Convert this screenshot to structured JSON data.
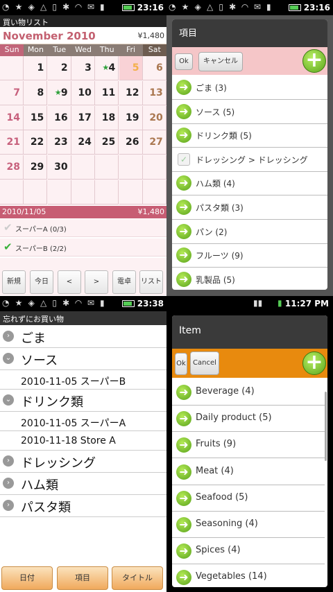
{
  "q1": {
    "status": {
      "time": "23:16"
    },
    "title": "買い物リスト",
    "month": "November 2010",
    "total": "¥1,480",
    "weekdays": [
      "Sun",
      "Mon",
      "Tue",
      "Wed",
      "Thu",
      "Fri",
      "Sat"
    ],
    "weeks": [
      [
        "",
        "1",
        "2",
        "3",
        "4",
        "5",
        "6"
      ],
      [
        "7",
        "8",
        "9",
        "10",
        "11",
        "12",
        "13"
      ],
      [
        "14",
        "15",
        "16",
        "17",
        "18",
        "19",
        "20"
      ],
      [
        "21",
        "22",
        "23",
        "24",
        "25",
        "26",
        "27"
      ],
      [
        "28",
        "29",
        "30",
        "",
        "",
        "",
        ""
      ],
      [
        "",
        "",
        "",
        "",
        "",
        "",
        ""
      ]
    ],
    "star_days": [
      "4",
      "9"
    ],
    "today": "5",
    "selected_date": "2010/11/05",
    "selected_amount": "¥1,480",
    "items": [
      {
        "label": "スーパーA (0/3)",
        "checked": false
      },
      {
        "label": "スーパーB (2/2)",
        "checked": true
      }
    ],
    "buttons": [
      "新規",
      "今日",
      "<",
      ">",
      "電卓",
      "リスト"
    ]
  },
  "q2": {
    "status": {
      "time": "23:16"
    },
    "dialog_title": "項目",
    "ok": "Ok",
    "cancel": "キャンセル",
    "rows": [
      {
        "label": "ごま (3)",
        "icon": "arrow-right-icon"
      },
      {
        "label": "ソース (5)",
        "icon": "arrow-right-icon"
      },
      {
        "label": "ドリンク類 (5)",
        "icon": "arrow-right-icon"
      },
      {
        "label": "ドレッシング > ドレッシング",
        "icon": "checkbox-icon"
      },
      {
        "label": "ハム類 (4)",
        "icon": "arrow-right-icon"
      },
      {
        "label": "パスタ類 (3)",
        "icon": "arrow-right-icon"
      },
      {
        "label": "パン (2)",
        "icon": "arrow-right-icon"
      },
      {
        "label": "フルーツ (9)",
        "icon": "arrow-right-icon"
      },
      {
        "label": "乳製品 (5)",
        "icon": "arrow-right-icon"
      }
    ]
  },
  "q3": {
    "status": {
      "time": "23:38"
    },
    "title": "忘れずにお買い物",
    "tree": [
      {
        "label": "ごま",
        "level": 0,
        "expanded": false
      },
      {
        "label": "ソース",
        "level": 0,
        "expanded": true
      },
      {
        "label": "2010-11-05 スーパーB",
        "level": 1
      },
      {
        "label": "ドリンク類",
        "level": 0,
        "expanded": true
      },
      {
        "label": "2010-11-05 スーパーA",
        "level": 1
      },
      {
        "label": "2010-11-18 Store A",
        "level": 1
      },
      {
        "label": "ドレッシング",
        "level": 0,
        "expanded": false
      },
      {
        "label": "ハム類",
        "level": 0,
        "expanded": false
      },
      {
        "label": "パスタ類",
        "level": 0,
        "expanded": false
      }
    ],
    "buttons": [
      "日付",
      "項目",
      "タイトル"
    ]
  },
  "q4": {
    "status": {
      "time": "11:27 PM"
    },
    "dialog_title": "Item",
    "ok": "Ok",
    "cancel": "Cancel",
    "rows": [
      {
        "label": "Beverage  (4)"
      },
      {
        "label": "Daily product  (5)"
      },
      {
        "label": "Fruits  (9)"
      },
      {
        "label": "Meat  (4)"
      },
      {
        "label": "Seafood  (5)"
      },
      {
        "label": "Seasoning  (4)"
      },
      {
        "label": "Spices  (4)"
      },
      {
        "label": "Vegetables  (14)"
      }
    ]
  },
  "colors": {
    "accent": "#c75d73",
    "orange": "#e88a0e",
    "green": "#5aa51c"
  }
}
